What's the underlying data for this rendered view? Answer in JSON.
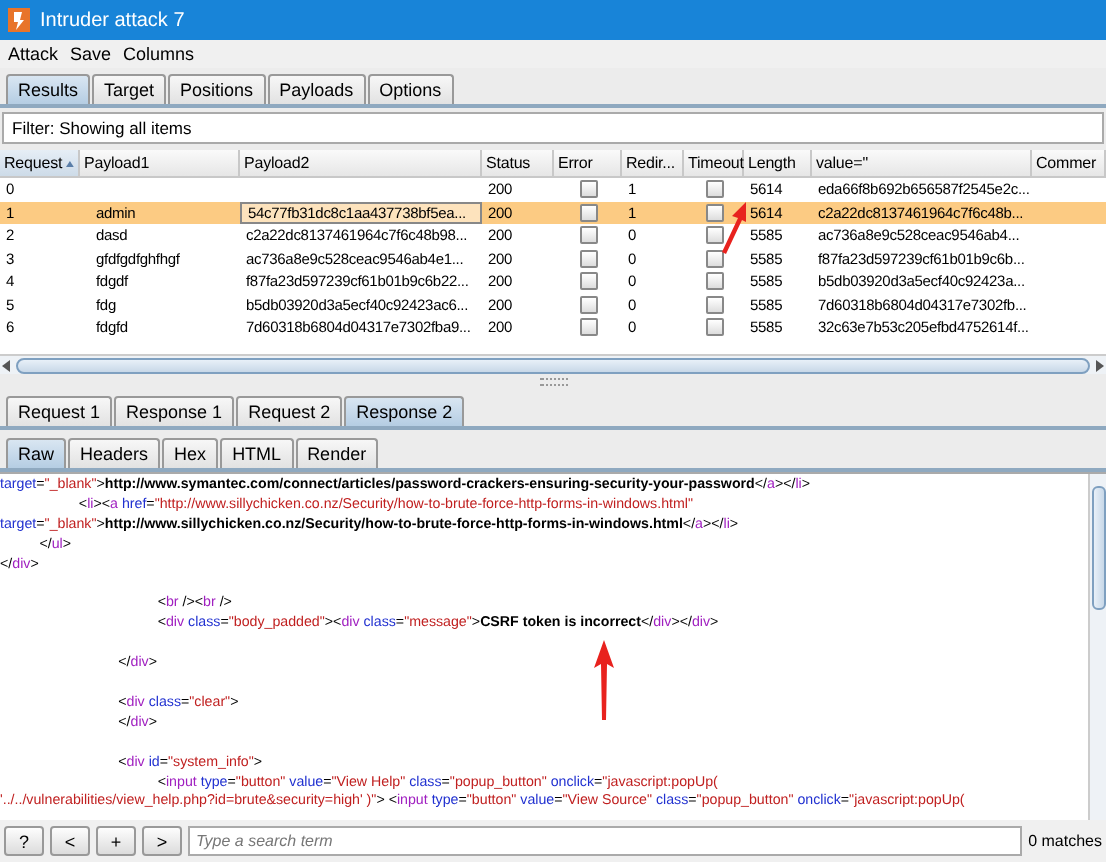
{
  "window": {
    "title": "Intruder attack 7"
  },
  "menu": [
    "Attack",
    "Save",
    "Columns"
  ],
  "tabs": [
    {
      "label": "Results",
      "selected": true
    },
    {
      "label": "Target",
      "selected": false
    },
    {
      "label": "Positions",
      "selected": false
    },
    {
      "label": "Payloads",
      "selected": false
    },
    {
      "label": "Options",
      "selected": false
    }
  ],
  "filter": "Filter: Showing all items",
  "table": {
    "columns": [
      {
        "label": "Request",
        "sorted": true
      },
      {
        "label": "Payload1",
        "sorted": false
      },
      {
        "label": "Payload2",
        "sorted": false
      },
      {
        "label": "Status",
        "sorted": false
      },
      {
        "label": "Error",
        "sorted": false
      },
      {
        "label": "Redir...",
        "sorted": false
      },
      {
        "label": "Timeout",
        "sorted": false
      },
      {
        "label": "Length",
        "sorted": false
      },
      {
        "label": "value=\"",
        "sorted": false
      },
      {
        "label": "Commer",
        "sorted": false
      }
    ],
    "rows": [
      {
        "request": "0",
        "payload1": "",
        "payload2": "",
        "status": "200",
        "error": false,
        "redirects": "1",
        "timeout": false,
        "length": "5614",
        "value": "eda66f8b692b656587f2545e2c...",
        "selected": false
      },
      {
        "request": "1",
        "payload1": "admin",
        "payload2": "54c77fb31dc8c1aa437738bf5ea...",
        "status": "200",
        "error": false,
        "redirects": "1",
        "timeout": false,
        "length": "5614",
        "value": "c2a22dc8137461964c7f6c48b...",
        "selected": true
      },
      {
        "request": "2",
        "payload1": "dasd",
        "payload2": "c2a22dc8137461964c7f6c48b98...",
        "status": "200",
        "error": false,
        "redirects": "0",
        "timeout": false,
        "length": "5585",
        "value": "ac736a8e9c528ceac9546ab4...",
        "selected": false
      },
      {
        "request": "3",
        "payload1": "gfdfgdfghfhgf",
        "payload2": "ac736a8e9c528ceac9546ab4e1...",
        "status": "200",
        "error": false,
        "redirects": "0",
        "timeout": false,
        "length": "5585",
        "value": "f87fa23d597239cf61b01b9c6b...",
        "selected": false
      },
      {
        "request": "4",
        "payload1": "fdgdf",
        "payload2": "f87fa23d597239cf61b01b9c6b22...",
        "status": "200",
        "error": false,
        "redirects": "0",
        "timeout": false,
        "length": "5585",
        "value": "b5db03920d3a5ecf40c92423a...",
        "selected": false
      },
      {
        "request": "5",
        "payload1": "fdg",
        "payload2": "b5db03920d3a5ecf40c92423ac6...",
        "status": "200",
        "error": false,
        "redirects": "0",
        "timeout": false,
        "length": "5585",
        "value": "7d60318b6804d04317e7302fb...",
        "selected": false
      },
      {
        "request": "6",
        "payload1": "fdgfd",
        "payload2": "7d60318b6804d04317e7302fba9...",
        "status": "200",
        "error": false,
        "redirects": "0",
        "timeout": false,
        "length": "5585",
        "value": "32c63e7b53c205efbd4752614f...",
        "selected": false
      }
    ]
  },
  "message_tabs": [
    {
      "label": "Request 1",
      "selected": false
    },
    {
      "label": "Response 1",
      "selected": false
    },
    {
      "label": "Request 2",
      "selected": false
    },
    {
      "label": "Response 2",
      "selected": true
    }
  ],
  "view_tabs": [
    {
      "label": "Raw",
      "selected": true
    },
    {
      "label": "Headers",
      "selected": false
    },
    {
      "label": "Hex",
      "selected": false
    },
    {
      "label": "HTML",
      "selected": false
    },
    {
      "label": "Render",
      "selected": false
    }
  ],
  "code_blocks": [
    [
      [
        {
          "kind": "attr",
          "text": "target"
        },
        {
          "kind": "punct",
          "text": "="
        },
        {
          "kind": "str",
          "text": "\"_blank\""
        },
        {
          "kind": "punct",
          "text": ">"
        },
        {
          "kind": "bold",
          "text": "http://www.symantec.com/connect/articles/password-crackers-ensuring-security-your-password"
        },
        {
          "kind": "punct",
          "text": "</"
        },
        {
          "kind": "tag",
          "text": "a"
        },
        {
          "kind": "punct",
          "text": "></"
        },
        {
          "kind": "tag",
          "text": "li"
        },
        {
          "kind": "punct",
          "text": ">"
        }
      ],
      [
        {
          "kind": "punct",
          "text": "                    <"
        },
        {
          "kind": "tag",
          "text": "li"
        },
        {
          "kind": "punct",
          "text": "><"
        },
        {
          "kind": "tag",
          "text": "a"
        },
        {
          "kind": "attr",
          "text": " href"
        },
        {
          "kind": "punct",
          "text": "="
        },
        {
          "kind": "str",
          "text": "\"http://www.sillychicken.co.nz/Security/how-to-brute-force-http-forms-in-windows.html\""
        }
      ],
      [
        {
          "kind": "attr",
          "text": "target"
        },
        {
          "kind": "punct",
          "text": "="
        },
        {
          "kind": "str",
          "text": "\"_blank\""
        },
        {
          "kind": "punct",
          "text": ">"
        },
        {
          "kind": "bold",
          "text": "http://www.sillychicken.co.nz/Security/how-to-brute-force-http-forms-in-windows.html"
        },
        {
          "kind": "punct",
          "text": "</"
        },
        {
          "kind": "tag",
          "text": "a"
        },
        {
          "kind": "punct",
          "text": "></"
        },
        {
          "kind": "tag",
          "text": "li"
        },
        {
          "kind": "punct",
          "text": ">"
        }
      ],
      [
        {
          "kind": "punct",
          "text": "          </"
        },
        {
          "kind": "tag",
          "text": "ul"
        },
        {
          "kind": "punct",
          "text": ">"
        }
      ],
      [
        {
          "kind": "punct",
          "text": "</"
        },
        {
          "kind": "tag",
          "text": "div"
        },
        {
          "kind": "punct",
          "text": ">"
        }
      ]
    ],
    [
      [
        {
          "kind": "punct",
          "text": "                                        <"
        },
        {
          "kind": "tag",
          "text": "br"
        },
        {
          "kind": "punct",
          "text": " /><"
        },
        {
          "kind": "tag",
          "text": "br"
        },
        {
          "kind": "punct",
          "text": " />"
        }
      ],
      [
        {
          "kind": "punct",
          "text": "                                        <"
        },
        {
          "kind": "tag",
          "text": "div"
        },
        {
          "kind": "attr",
          "text": " class"
        },
        {
          "kind": "punct",
          "text": "="
        },
        {
          "kind": "str",
          "text": "\"body_padded\""
        },
        {
          "kind": "punct",
          "text": "><"
        },
        {
          "kind": "tag",
          "text": "div"
        },
        {
          "kind": "attr",
          "text": " class"
        },
        {
          "kind": "punct",
          "text": "="
        },
        {
          "kind": "str",
          "text": "\"message\""
        },
        {
          "kind": "punct",
          "text": ">"
        },
        {
          "kind": "bold",
          "text": "CSRF token is incorrect"
        },
        {
          "kind": "punct",
          "text": "</"
        },
        {
          "kind": "tag",
          "text": "div"
        },
        {
          "kind": "punct",
          "text": "></"
        },
        {
          "kind": "tag",
          "text": "div"
        },
        {
          "kind": "punct",
          "text": ">"
        }
      ]
    ],
    [
      [
        {
          "kind": "punct",
          "text": "                              </"
        },
        {
          "kind": "tag",
          "text": "div"
        },
        {
          "kind": "punct",
          "text": ">"
        }
      ]
    ],
    [
      [
        {
          "kind": "punct",
          "text": "                              <"
        },
        {
          "kind": "tag",
          "text": "div"
        },
        {
          "kind": "attr",
          "text": " class"
        },
        {
          "kind": "punct",
          "text": "="
        },
        {
          "kind": "str",
          "text": "\"clear\""
        },
        {
          "kind": "punct",
          "text": ">"
        }
      ],
      [
        {
          "kind": "punct",
          "text": "                              </"
        },
        {
          "kind": "tag",
          "text": "div"
        },
        {
          "kind": "punct",
          "text": ">"
        }
      ]
    ],
    [
      [
        {
          "kind": "punct",
          "text": "                              <"
        },
        {
          "kind": "tag",
          "text": "div"
        },
        {
          "kind": "attr",
          "text": " id"
        },
        {
          "kind": "punct",
          "text": "="
        },
        {
          "kind": "str",
          "text": "\"system_info\""
        },
        {
          "kind": "punct",
          "text": ">"
        }
      ],
      [
        {
          "kind": "punct",
          "text": "                                        <"
        },
        {
          "kind": "tag",
          "text": "input"
        },
        {
          "kind": "attr",
          "text": " type"
        },
        {
          "kind": "punct",
          "text": "="
        },
        {
          "kind": "str",
          "text": "\"button\""
        },
        {
          "kind": "attr",
          "text": " value"
        },
        {
          "kind": "punct",
          "text": "="
        },
        {
          "kind": "str",
          "text": "\"View Help\""
        },
        {
          "kind": "attr",
          "text": " class"
        },
        {
          "kind": "punct",
          "text": "="
        },
        {
          "kind": "str",
          "text": "\"popup_button\""
        },
        {
          "kind": "attr",
          "text": " onclick"
        },
        {
          "kind": "punct",
          "text": "="
        },
        {
          "kind": "str",
          "text": "\"javascript:popUp("
        }
      ],
      [
        {
          "kind": "str",
          "text": "'../../vulnerabilities/view_help.php?id=brute&security=high' )\""
        },
        {
          "kind": "punct",
          "text": "> <"
        },
        {
          "kind": "tag",
          "text": "input"
        },
        {
          "kind": "attr",
          "text": " type"
        },
        {
          "kind": "punct",
          "text": "="
        },
        {
          "kind": "str",
          "text": "\"button\""
        },
        {
          "kind": "attr",
          "text": " value"
        },
        {
          "kind": "punct",
          "text": "="
        },
        {
          "kind": "str",
          "text": "\"View Source\""
        },
        {
          "kind": "attr",
          "text": " class"
        },
        {
          "kind": "punct",
          "text": "="
        },
        {
          "kind": "str",
          "text": "\"popup_button\""
        },
        {
          "kind": "attr",
          "text": " onclick"
        },
        {
          "kind": "punct",
          "text": "="
        },
        {
          "kind": "str",
          "text": "\"javascript:popUp("
        }
      ]
    ]
  ],
  "search": {
    "buttons": [
      "?",
      "<",
      "+",
      ">"
    ],
    "placeholder": "Type a search term",
    "matches": "0 matches"
  }
}
